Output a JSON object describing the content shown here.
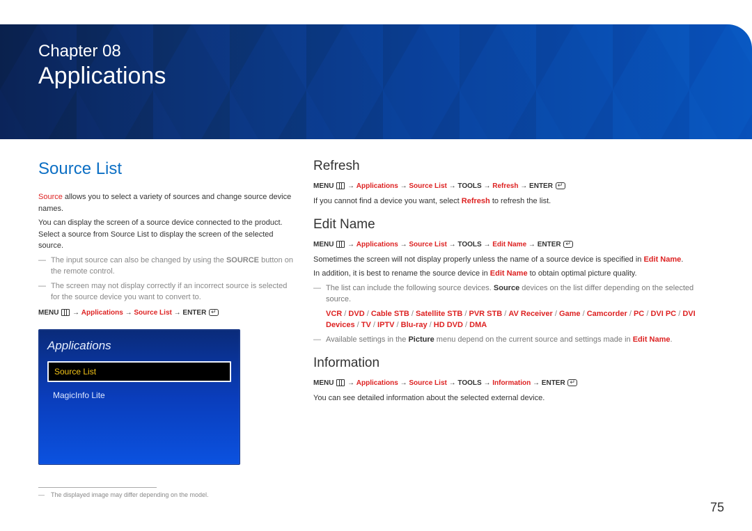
{
  "page_number": "75",
  "chapter_label": "Chapter 08",
  "chapter_title": "Applications",
  "left": {
    "section_title": "Source List",
    "para1_pre": "Source",
    "para1_post": " allows you to select a variety of sources and change source device names.",
    "para2": "You can display the screen of a source device connected to the product. Select a source from Source List to display the screen of the selected source.",
    "note1_pre": "The input source can also be changed by using the ",
    "note1_bold": "SOURCE",
    "note1_post": " button on the remote control.",
    "note2": "The screen may not display correctly if an incorrect source is selected for the source device you want to convert to.",
    "nav": {
      "menu": "MENU",
      "seg1": "Applications",
      "seg2": "Source List",
      "enter": "ENTER"
    },
    "osd": {
      "title": "Applications",
      "item_selected": "Source List",
      "item2": "MagicInfo Lite"
    },
    "footnote": "The displayed image may differ depending on the model."
  },
  "right": {
    "refresh": {
      "title": "Refresh",
      "nav": {
        "menu": "MENU",
        "seg1": "Applications",
        "seg2": "Source List",
        "seg3": "TOOLS",
        "seg4": "Refresh",
        "enter": "ENTER"
      },
      "p1_pre": "If you cannot find a device you want, select ",
      "p1_bold": "Refresh",
      "p1_post": " to refresh the list."
    },
    "editname": {
      "title": "Edit Name",
      "nav": {
        "menu": "MENU",
        "seg1": "Applications",
        "seg2": "Source List",
        "seg3": "TOOLS",
        "seg4": "Edit Name",
        "enter": "ENTER"
      },
      "p1_pre": "Sometimes the screen will not display properly unless the name of a source device is specified in ",
      "p1_bold": "Edit Name",
      "p1_post": ".",
      "p2_pre": "In addition, it is best to rename the source device in ",
      "p2_bold": "Edit Name",
      "p2_post": " to obtain optimal picture quality.",
      "note1_pre": "The list can include the following source devices. ",
      "note1_bold": "Source",
      "note1_post": " devices on the list differ depending on the selected source.",
      "devices": [
        "VCR",
        "DVD",
        "Cable STB",
        "Satellite STB",
        "PVR STB",
        "AV Receiver",
        "Game",
        "Camcorder",
        "PC",
        "DVI PC",
        "DVI Devices",
        "TV",
        "IPTV",
        "Blu-ray",
        "HD DVD",
        "DMA"
      ],
      "note2_pre": "Available settings in the ",
      "note2_bold": "Picture",
      "note2_mid": " menu depend on the current source and settings made in ",
      "note2_bold2": "Edit Name",
      "note2_post": "."
    },
    "information": {
      "title": "Information",
      "nav": {
        "menu": "MENU",
        "seg1": "Applications",
        "seg2": "Source List",
        "seg3": "TOOLS",
        "seg4": "Information",
        "enter": "ENTER"
      },
      "p1": "You can see detailed information about the selected external device."
    }
  }
}
